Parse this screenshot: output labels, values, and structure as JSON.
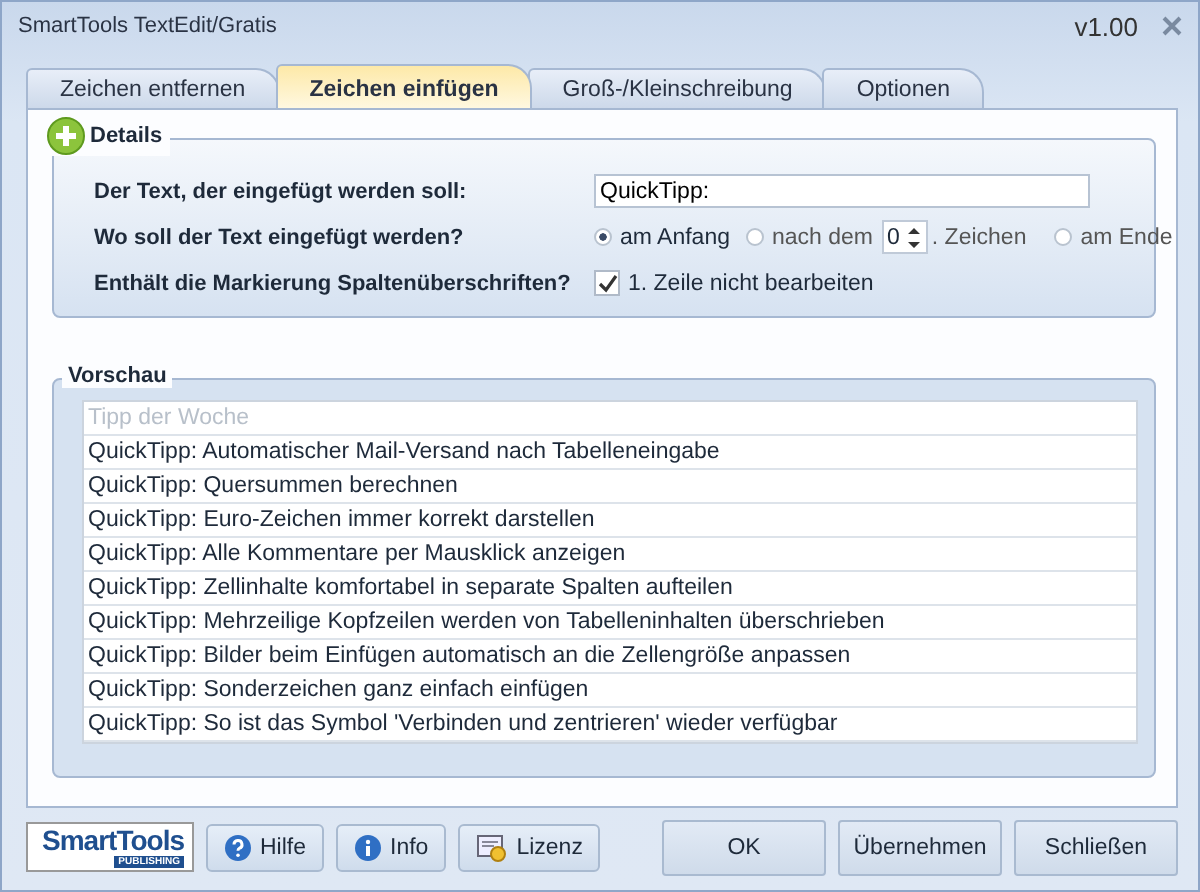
{
  "window": {
    "title": "SmartTools TextEdit/Gratis",
    "version": "v1.00"
  },
  "tabs": [
    {
      "label": "Zeichen entfernen",
      "selected": false
    },
    {
      "label": "Zeichen einfügen",
      "selected": true
    },
    {
      "label": "Groß-/Kleinschreibung",
      "selected": false
    },
    {
      "label": "Optionen",
      "selected": false
    }
  ],
  "details": {
    "title": "Details",
    "text_label": "Der Text, der eingefügt werden soll:",
    "text_value": "QuickTipp:",
    "position_label": "Wo soll der Text eingefügt werden?",
    "positions": [
      {
        "label": "am Anfang",
        "selected": true
      },
      {
        "label": "nach dem",
        "selected": false
      },
      {
        "label": "am Ende",
        "selected": false
      }
    ],
    "count": "0",
    "count_suffix": ". Zeichen",
    "header_label": "Enthält die Markierung Spaltenüberschriften?",
    "header_option": {
      "label": "1. Zeile nicht bearbeiten",
      "checked": true
    }
  },
  "preview": {
    "title": "Vorschau",
    "header": "Tipp der Woche",
    "rows": [
      "QuickTipp: Automatischer Mail-Versand nach Tabelleneingabe",
      "QuickTipp: Quersummen berechnen",
      "QuickTipp: Euro-Zeichen immer korrekt darstellen",
      "QuickTipp: Alle Kommentare per Mausklick anzeigen",
      "QuickTipp: Zellinhalte komfortabel in separate Spalten aufteilen",
      "QuickTipp: Mehrzeilige Kopfzeilen werden von Tabelleninhalten überschrieben",
      "QuickTipp: Bilder beim Einfügen automatisch an die Zellengröße anpassen",
      "QuickTipp: Sonderzeichen ganz einfach einfügen",
      "QuickTipp: So ist das Symbol 'Verbinden und zentrieren' wieder verfügbar"
    ]
  },
  "logo": {
    "name": "SmartTools",
    "tagline": "PUBLISHING"
  },
  "help_buttons": [
    {
      "kind": "help",
      "label": "Hilfe"
    },
    {
      "kind": "info",
      "label": "Info"
    },
    {
      "kind": "license",
      "label": "Lizenz"
    }
  ],
  "buttons": [
    "OK",
    "Übernehmen",
    "Schließen"
  ]
}
